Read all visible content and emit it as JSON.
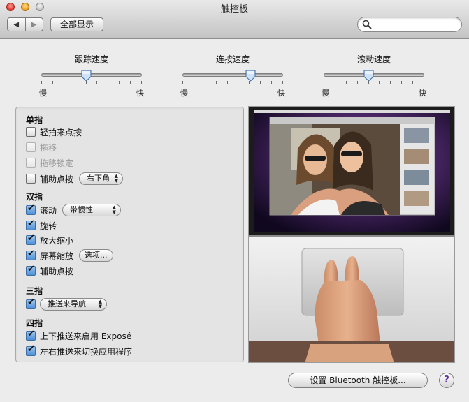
{
  "window": {
    "title": "触控板"
  },
  "toolbar": {
    "back_label": "◀",
    "forward_label": "▶",
    "show_all_label": "全部显示",
    "search_placeholder": ""
  },
  "sliders": [
    {
      "label": "跟踪速度",
      "min_label": "慢",
      "max_label": "快",
      "value": 0.45
    },
    {
      "label": "连按速度",
      "min_label": "慢",
      "max_label": "快",
      "value": 0.68
    },
    {
      "label": "滚动速度",
      "min_label": "慢",
      "max_label": "快",
      "value": 0.45
    }
  ],
  "sections": {
    "one_finger": {
      "title": "单指",
      "tap_to_click": {
        "label": "轻拍来点按",
        "checked": false
      },
      "dragging": {
        "label": "拖移",
        "checked": false
      },
      "drag_lock": {
        "label": "拖移锁定",
        "checked": false
      },
      "secondary_click": {
        "label": "辅助点按",
        "checked": false,
        "option": "右下角"
      }
    },
    "two_fingers": {
      "title": "双指",
      "scroll": {
        "label": "滚动",
        "checked": true,
        "option": "带惯性"
      },
      "rotate": {
        "label": "旋转",
        "checked": true
      },
      "pinch_zoom": {
        "label": "放大缩小",
        "checked": true
      },
      "screen_zoom": {
        "label": "屏幕缩放",
        "checked": true,
        "button": "选项..."
      },
      "secondary_click": {
        "label": "辅助点按",
        "checked": true
      }
    },
    "three_fingers": {
      "title": "三指",
      "swipe": {
        "checked": true,
        "option": "推送来导航"
      }
    },
    "four_fingers": {
      "title": "四指",
      "expose": {
        "label": "上下推送来启用 Exposé",
        "checked": true
      },
      "switch_apps": {
        "label": "左右推送来切换应用程序",
        "checked": true
      }
    }
  },
  "footer": {
    "bluetooth_button": "设置 Bluetooth 触控板...",
    "help_label": "?"
  },
  "icons": {
    "search": "search-icon",
    "help": "help-icon"
  },
  "colors": {
    "accent_check": "#4f8fd6",
    "help_text": "#5b2fa3"
  }
}
